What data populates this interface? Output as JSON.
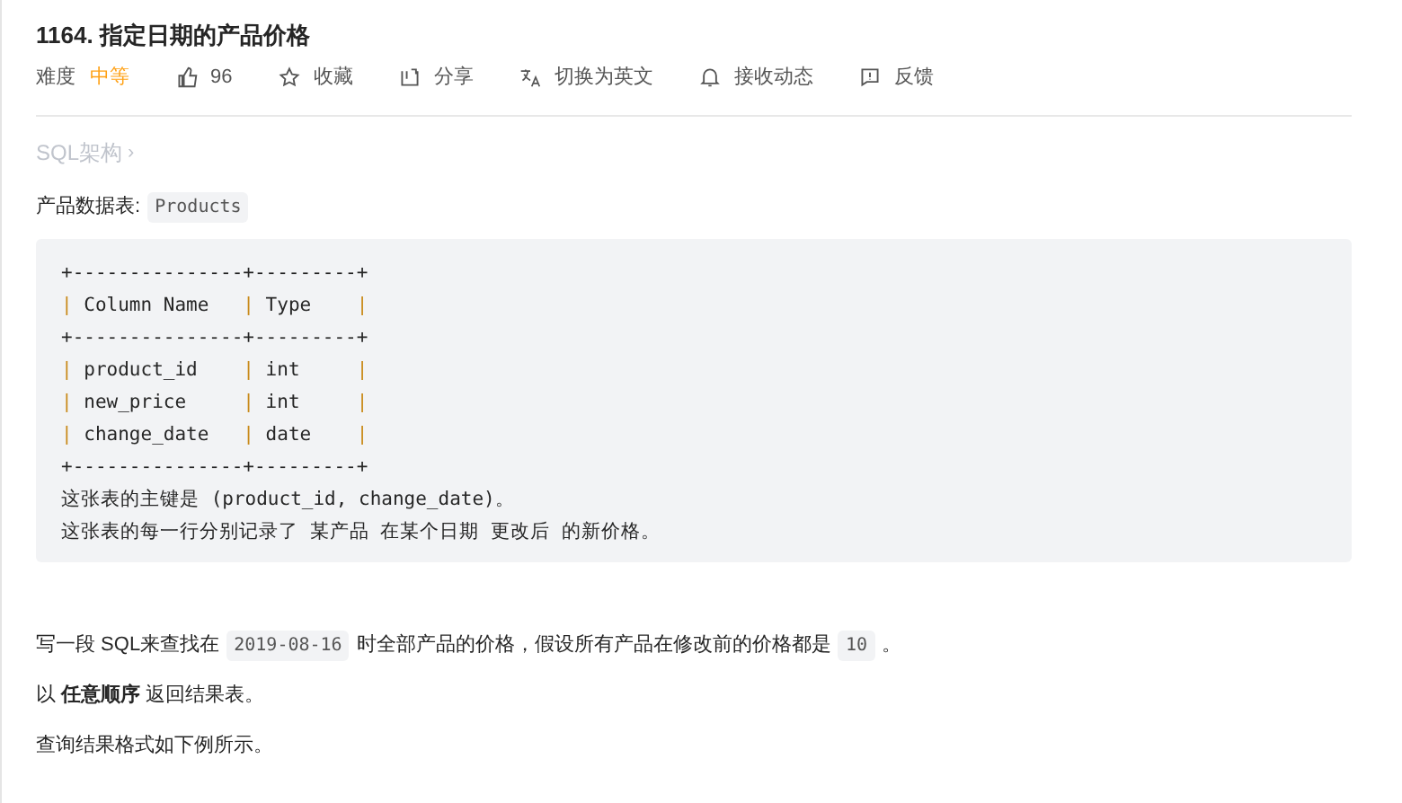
{
  "title": "1164. 指定日期的产品价格",
  "toolbar": {
    "difficulty_label": "难度",
    "difficulty": "中等",
    "actions": [
      {
        "kind": "like",
        "label": "96"
      },
      {
        "kind": "star",
        "label": "收藏"
      },
      {
        "kind": "share",
        "label": "分享"
      },
      {
        "kind": "translate",
        "label": "切换为英文"
      },
      {
        "kind": "bell",
        "label": "接收动态"
      },
      {
        "kind": "feedback",
        "label": "反馈"
      }
    ]
  },
  "breadcrumb": {
    "label": "SQL架构",
    "chevron": "›"
  },
  "table_intro": [
    {
      "kind": "text",
      "text": "产品数据表: "
    },
    {
      "kind": "code",
      "text": "Products"
    }
  ],
  "code_block": [
    "+---------------+---------+",
    "| Column Name   | Type    |",
    "+---------------+---------+",
    "| product_id    | int     |",
    "| new_price     | int     |",
    "| change_date   | date    |",
    "+---------------+---------+",
    "这张表的主键是 (product_id, change_date)。",
    "这张表的每一行分别记录了 某产品 在某个日期 更改后 的新价格。"
  ],
  "paragraphs": [
    [
      {
        "kind": "text",
        "text": "写一段 SQL来查找在 "
      },
      {
        "kind": "code",
        "text": "2019-08-16"
      },
      {
        "kind": "text",
        "text": " 时全部产品的价格，假设所有产品在修改前的价格都是 "
      },
      {
        "kind": "code",
        "text": "10"
      },
      {
        "kind": "text",
        "text": " 。"
      }
    ],
    [
      {
        "kind": "text",
        "text": "以 **任意顺序** 返回结果表。"
      }
    ],
    [
      {
        "kind": "text",
        "text": "查询结果格式如下例所示。"
      }
    ]
  ]
}
